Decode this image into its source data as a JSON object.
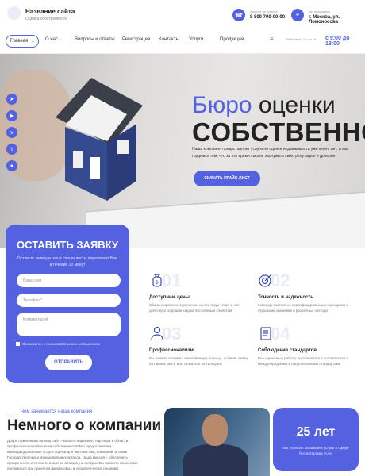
{
  "header": {
    "site_title": "Название сайта",
    "site_subtitle": "Оценка собственности",
    "phone_label": "звоните по номеру",
    "phone": "8 800 700-00-00",
    "address_label": "мы находимся",
    "address": "г. Москва, ул. Ломоносова"
  },
  "nav": {
    "items": [
      "Главная",
      "О нас",
      "Вопросы и ответы",
      "Регистрация",
      "Контакты",
      "Услуги",
      "Продукция"
    ],
    "hours_label": "Работаем | Пн по Пт",
    "hours_value": "с 9:00 до 18:00"
  },
  "hero": {
    "title_accent": "Бюро",
    "title_rest": "оценки",
    "title_line2": "СОБСТВЕННОСТИ",
    "description": "Наша компания предоставляет услуги по оценке недвижимости уже много лет, и мы гордимся тем, что за это время смогли заслужить свою репутацию и доверие",
    "button": "СКАЧАТЬ ПРАЙС-ЛИСТ"
  },
  "form": {
    "title": "ОСТАВИТЬ ЗАЯВКУ",
    "description": "Оставьте заявку и наши специалисты перезвонят Вам в течение 10 минут",
    "name_placeholder": "Ваше имя",
    "phone_placeholder": "Телефон *",
    "comment_placeholder": "Комментарий",
    "consent": "Ознакомлен с пользовательским соглашением",
    "submit": "ОТПРАВИТЬ"
  },
  "features": [
    {
      "num": "01",
      "title": "Доступные цены",
      "text": "Сбалансированные расценки на все виды услуг. У нас действуют хорошие скидки постоянным клиентам"
    },
    {
      "num": "02",
      "title": "Точность и надежность",
      "text": "Команда состоит из сертифицированных оценщиков с глубокими знаниями в различных сектора"
    },
    {
      "num": "03",
      "title": "Профессионализм",
      "text": "Вы можете получить качественную помощь, оставив заявку на нашем сайте или связаться по телефону"
    },
    {
      "num": "04",
      "title": "Соблюдение стандартов",
      "text": "Все оценочные работы выполняются в соответствии с международными и национальными стандартами"
    }
  ],
  "about": {
    "tag": "Чем занимается наша компания",
    "title": "Немного о компании",
    "text": "Добро пожаловать на наш сайт – Вашего надежного партнера в области профессиональной оценки собственности! Мы предоставляем квалифицированные услуги оценки для частных лиц, компаний, а также Государственных и муниципальных органов. Наша миссия – обеспечить прозрачность и точность в оценке активов, на которых Вы сможете полностью положиться при принятии финансовых и управленческих решений.",
    "years": "25 лет",
    "years_text": "Мы успешно оказываем услуги в сфере бухгалтерские услуг"
  },
  "colors": {
    "accent": "#5461e0"
  }
}
